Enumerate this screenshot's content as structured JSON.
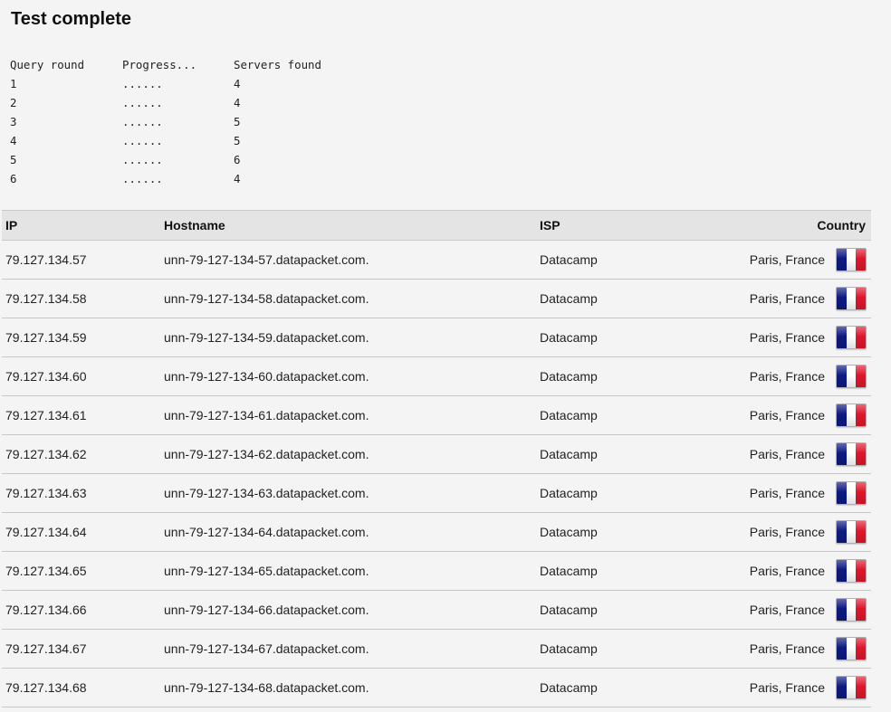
{
  "page": {
    "title": "Test complete"
  },
  "rounds": {
    "headers": [
      "Query round",
      "Progress...",
      "Servers found"
    ],
    "rows": [
      {
        "round": "1",
        "progress": "......",
        "servers": "4"
      },
      {
        "round": "2",
        "progress": "......",
        "servers": "4"
      },
      {
        "round": "3",
        "progress": "......",
        "servers": "5"
      },
      {
        "round": "4",
        "progress": "......",
        "servers": "5"
      },
      {
        "round": "5",
        "progress": "......",
        "servers": "6"
      },
      {
        "round": "6",
        "progress": "......",
        "servers": "4"
      }
    ]
  },
  "servers": {
    "headers": {
      "ip": "IP",
      "hostname": "Hostname",
      "isp": "ISP",
      "country": "Country"
    },
    "flag_colors": {
      "blue": "#0d1a80",
      "white": "#ffffff",
      "red": "#e0162b"
    },
    "rows": [
      {
        "ip": "79.127.134.57",
        "hostname": "unn-79-127-134-57.datapacket.com.",
        "isp": "Datacamp",
        "country": "Paris, France",
        "flag": "france-flag-icon"
      },
      {
        "ip": "79.127.134.58",
        "hostname": "unn-79-127-134-58.datapacket.com.",
        "isp": "Datacamp",
        "country": "Paris, France",
        "flag": "france-flag-icon"
      },
      {
        "ip": "79.127.134.59",
        "hostname": "unn-79-127-134-59.datapacket.com.",
        "isp": "Datacamp",
        "country": "Paris, France",
        "flag": "france-flag-icon"
      },
      {
        "ip": "79.127.134.60",
        "hostname": "unn-79-127-134-60.datapacket.com.",
        "isp": "Datacamp",
        "country": "Paris, France",
        "flag": "france-flag-icon"
      },
      {
        "ip": "79.127.134.61",
        "hostname": "unn-79-127-134-61.datapacket.com.",
        "isp": "Datacamp",
        "country": "Paris, France",
        "flag": "france-flag-icon"
      },
      {
        "ip": "79.127.134.62",
        "hostname": "unn-79-127-134-62.datapacket.com.",
        "isp": "Datacamp",
        "country": "Paris, France",
        "flag": "france-flag-icon"
      },
      {
        "ip": "79.127.134.63",
        "hostname": "unn-79-127-134-63.datapacket.com.",
        "isp": "Datacamp",
        "country": "Paris, France",
        "flag": "france-flag-icon"
      },
      {
        "ip": "79.127.134.64",
        "hostname": "unn-79-127-134-64.datapacket.com.",
        "isp": "Datacamp",
        "country": "Paris, France",
        "flag": "france-flag-icon"
      },
      {
        "ip": "79.127.134.65",
        "hostname": "unn-79-127-134-65.datapacket.com.",
        "isp": "Datacamp",
        "country": "Paris, France",
        "flag": "france-flag-icon"
      },
      {
        "ip": "79.127.134.66",
        "hostname": "unn-79-127-134-66.datapacket.com.",
        "isp": "Datacamp",
        "country": "Paris, France",
        "flag": "france-flag-icon"
      },
      {
        "ip": "79.127.134.67",
        "hostname": "unn-79-127-134-67.datapacket.com.",
        "isp": "Datacamp",
        "country": "Paris, France",
        "flag": "france-flag-icon"
      },
      {
        "ip": "79.127.134.68",
        "hostname": "unn-79-127-134-68.datapacket.com.",
        "isp": "Datacamp",
        "country": "Paris, France",
        "flag": "france-flag-icon"
      }
    ]
  }
}
